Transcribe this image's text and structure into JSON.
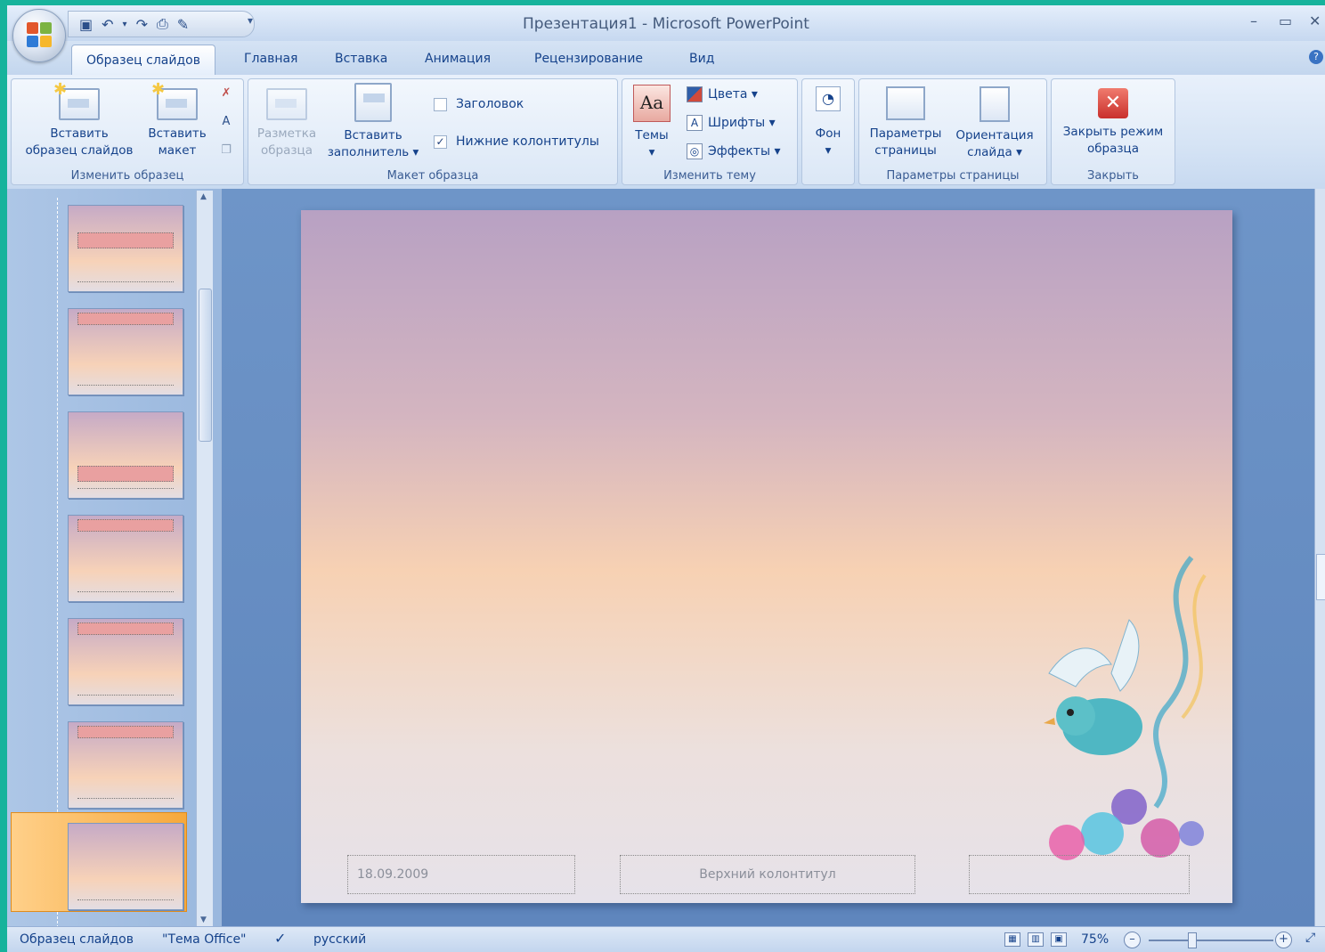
{
  "window": {
    "title": "Презентация1 - Microsoft PowerPoint",
    "controls": {
      "minimize": "–",
      "restore": "▭",
      "close": "✕"
    }
  },
  "quick_access": {
    "icons": [
      "save-icon",
      "undo-icon",
      "redo-icon",
      "print-preview-icon",
      "spelling-icon"
    ],
    "glyphs": {
      "save": "▣",
      "undo": "↶",
      "undo_dd": "▾",
      "redo": "↷",
      "preview": "⎙",
      "spell": "✎",
      "more": "▾"
    }
  },
  "tabs": [
    "Образец слайдов",
    "Главная",
    "Вставка",
    "Анимация",
    "Рецензирование",
    "Вид"
  ],
  "help": "?",
  "ribbon": {
    "edit_master": {
      "label": "Изменить образец",
      "insert_master_line1": "Вставить",
      "insert_master_line2": "образец слайдов",
      "insert_layout_line1": "Вставить",
      "insert_layout_line2": "макет",
      "star": "✱",
      "small_icons": [
        "✗",
        "A",
        "❐"
      ]
    },
    "master_layout": {
      "label": "Макет образца",
      "layout_line1": "Разметка",
      "layout_line2": "образца",
      "insert_ph_line1": "Вставить",
      "insert_ph_line2": "заполнитель ▾",
      "title_checkbox": "Заголовок",
      "title_checked": false,
      "footers_checkbox": "Нижние колонтитулы",
      "footers_checked": true,
      "check_mark": "✓"
    },
    "edit_theme": {
      "label": "Изменить тему",
      "themes": "Темы",
      "themes_glyph": "Aa",
      "colors": "Цвета ▾",
      "fonts": "Шрифты ▾",
      "effects": "Эффекты ▾",
      "dropdown": "▾"
    },
    "background": {
      "label": "Фон",
      "glyph": "◔",
      "dropdown": "▾"
    },
    "page_setup": {
      "label": "Параметры страницы",
      "setup_line1": "Параметры",
      "setup_line2": "страницы",
      "orient_line1": "Ориентация",
      "orient_line2": "слайда ▾"
    },
    "close": {
      "label": "Закрыть",
      "close_line1": "Закрыть режим",
      "close_line2": "образца",
      "glyph": "✕"
    }
  },
  "slide": {
    "date": "18.09.2009",
    "footer": "Верхний колонтитул",
    "number": ""
  },
  "scroll": {
    "up": "▲",
    "down": "▼",
    "grip": "≡"
  },
  "status_bar": {
    "mode": "Образец слайдов",
    "theme": "\"Тема Office\"",
    "spell_glyph": "✓",
    "language": "русский",
    "views": [
      "▦",
      "▥",
      "▣"
    ],
    "zoom": "75%",
    "zoom_minus": "–",
    "zoom_plus": "+",
    "fit": "⤢"
  },
  "colors": {
    "accent": "#15428b",
    "selection": "#f6a83b",
    "teal_frame": "#16b39c"
  }
}
